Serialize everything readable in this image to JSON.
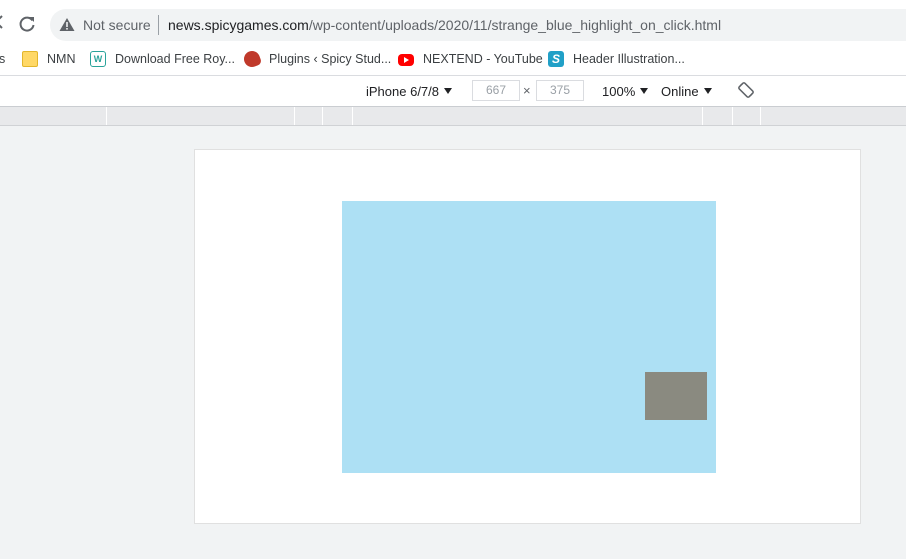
{
  "address_bar": {
    "security_label": "Not secure",
    "url_host": "news.spicygames.com",
    "url_path": "/wp-content/uploads/2020/11/strange_blue_highlight_on_click.html"
  },
  "bookmarks": [
    {
      "label": "s",
      "icon": "none"
    },
    {
      "label": "NMN",
      "icon": "folder-icon"
    },
    {
      "label": "Download Free Roy...",
      "icon": "site-icon"
    },
    {
      "label": "Plugins ‹ Spicy Stud...",
      "icon": "spicy-icon"
    },
    {
      "label": "NEXTEND - YouTube",
      "icon": "youtube-icon"
    },
    {
      "label": "Header Illustration...",
      "icon": "s-logo-icon"
    }
  ],
  "device_toolbar": {
    "device": "iPhone 6/7/8",
    "width": "667",
    "times": "×",
    "height": "375",
    "zoom": "100%",
    "network": "Online"
  },
  "colors": {
    "blue_box": "#ade0f4",
    "gray_box": "#8a8a80",
    "viewport_bg": "#ffffff",
    "canvas_bg": "#f1f3f4"
  }
}
